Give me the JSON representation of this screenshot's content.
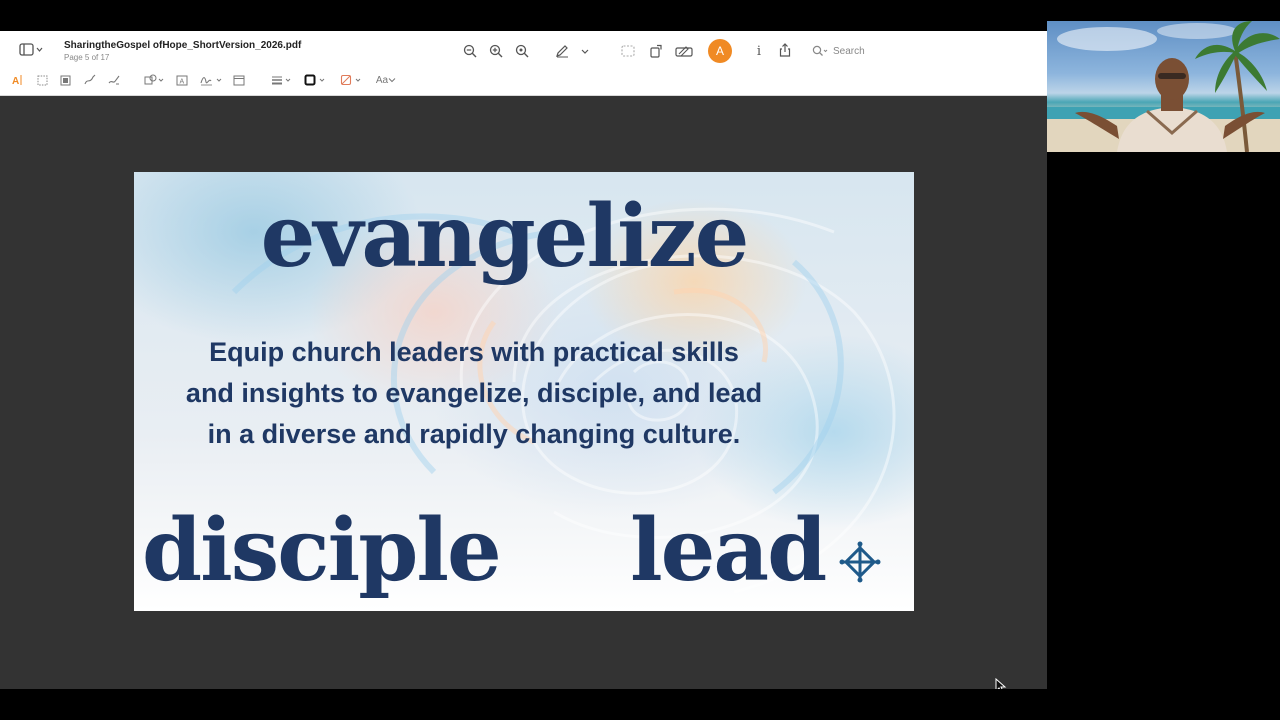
{
  "viewer": {
    "filename": "SharingtheGospel ofHope_ShortVersion_2026.pdf",
    "page_indicator": "Page 5 of 17",
    "search_placeholder": "Search",
    "markup_glyph": "A",
    "info_glyph": "i",
    "font_menu_label": "Aa",
    "toolbar_icons": [
      "sidebar-icon",
      "zoom-out-icon",
      "zoom-in-icon",
      "zoom-fit-icon",
      "pen-icon",
      "crop-icon",
      "rotate-icon",
      "form-icon",
      "markup-icon",
      "info-icon",
      "share-icon",
      "search-icon"
    ],
    "accent_color": "#f08a24"
  },
  "slide": {
    "top_word": "evangelize",
    "body_lines": [
      "Equip church leaders with practical skills",
      "and insights to evangelize, disciple, and lead",
      "in a diverse and rapidly changing culture."
    ],
    "bottom_left_word": "disciple",
    "bottom_right_word": "lead",
    "text_color": "#1f3864"
  },
  "video": {
    "description_icon": "participant-video"
  }
}
